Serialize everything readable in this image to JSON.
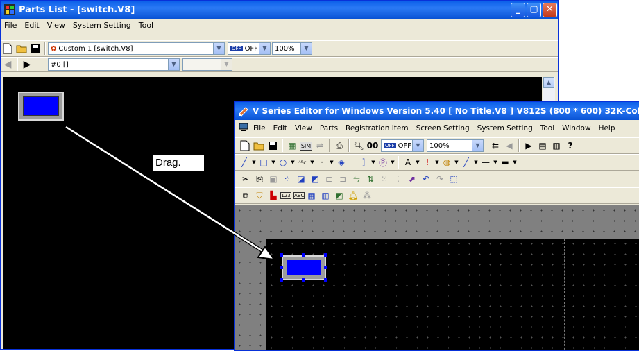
{
  "parts_window": {
    "title": "Parts List - [switch.V8]",
    "menu": [
      "File",
      "Edit",
      "View",
      "System Setting",
      "Tool"
    ],
    "library_select": "Custom 1 [switch.V8]",
    "off_label": "OFF",
    "zoom": "100%",
    "page_select": "#0 []"
  },
  "editor_window": {
    "title": "V Series Editor for Windows Version 5.40 [ No Title.V8 ] V812S (800 * 600) 32K-Colo",
    "menu": [
      "File",
      "Edit",
      "View",
      "Parts",
      "Registration Item",
      "Screen Setting",
      "System Setting",
      "Tool",
      "Window",
      "Help"
    ],
    "off_label": "OFF",
    "zoom": "100%"
  },
  "annotation": {
    "drag_label": "Drag."
  },
  "colors": {
    "part_blue": "#0000ff",
    "canvas": "#000000",
    "title_blue": "#0a5ee8"
  }
}
